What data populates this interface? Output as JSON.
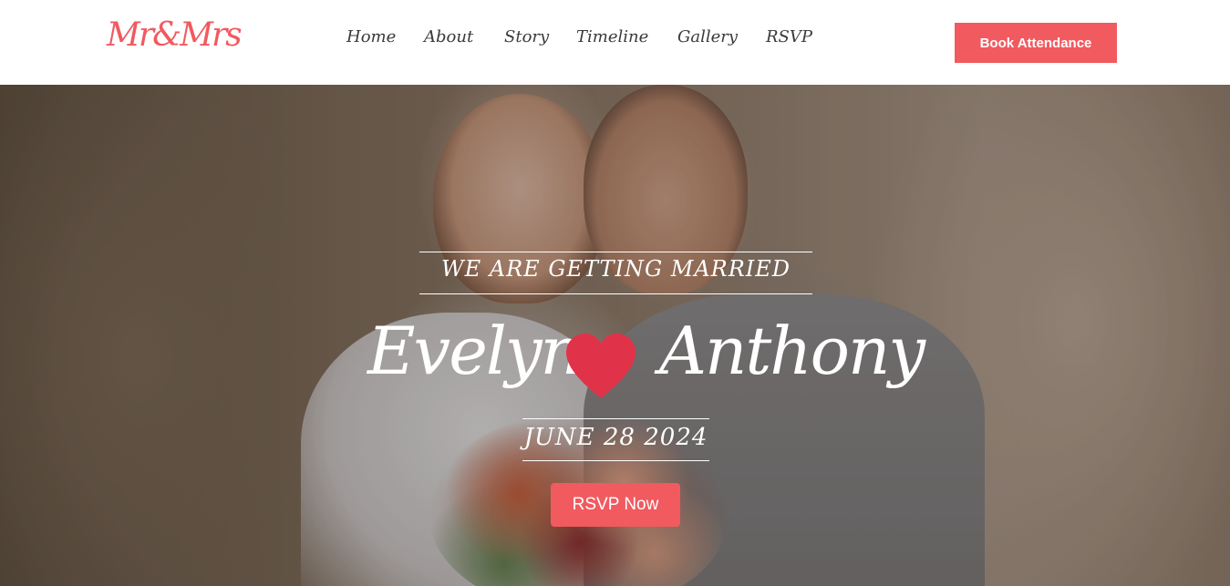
{
  "brand": {
    "logo_text": "Mr&Mrs",
    "accent_color": "#f15a5f"
  },
  "nav": {
    "items": [
      {
        "label": "Home"
      },
      {
        "label": "About"
      },
      {
        "label": "Story"
      },
      {
        "label": "Timeline"
      },
      {
        "label": "Gallery"
      },
      {
        "label": "RSVP"
      }
    ],
    "cta_label": "Book Attendance"
  },
  "hero": {
    "background_image": "couple-photo",
    "tagline": "WE ARE GETTING MARRIED",
    "name_left": "Evelyn",
    "name_right": "Anthony",
    "heart_icon": "heart-icon",
    "heart_color": "#e0334a",
    "date": "JUNE 28 2024",
    "button_label": "RSVP Now"
  }
}
